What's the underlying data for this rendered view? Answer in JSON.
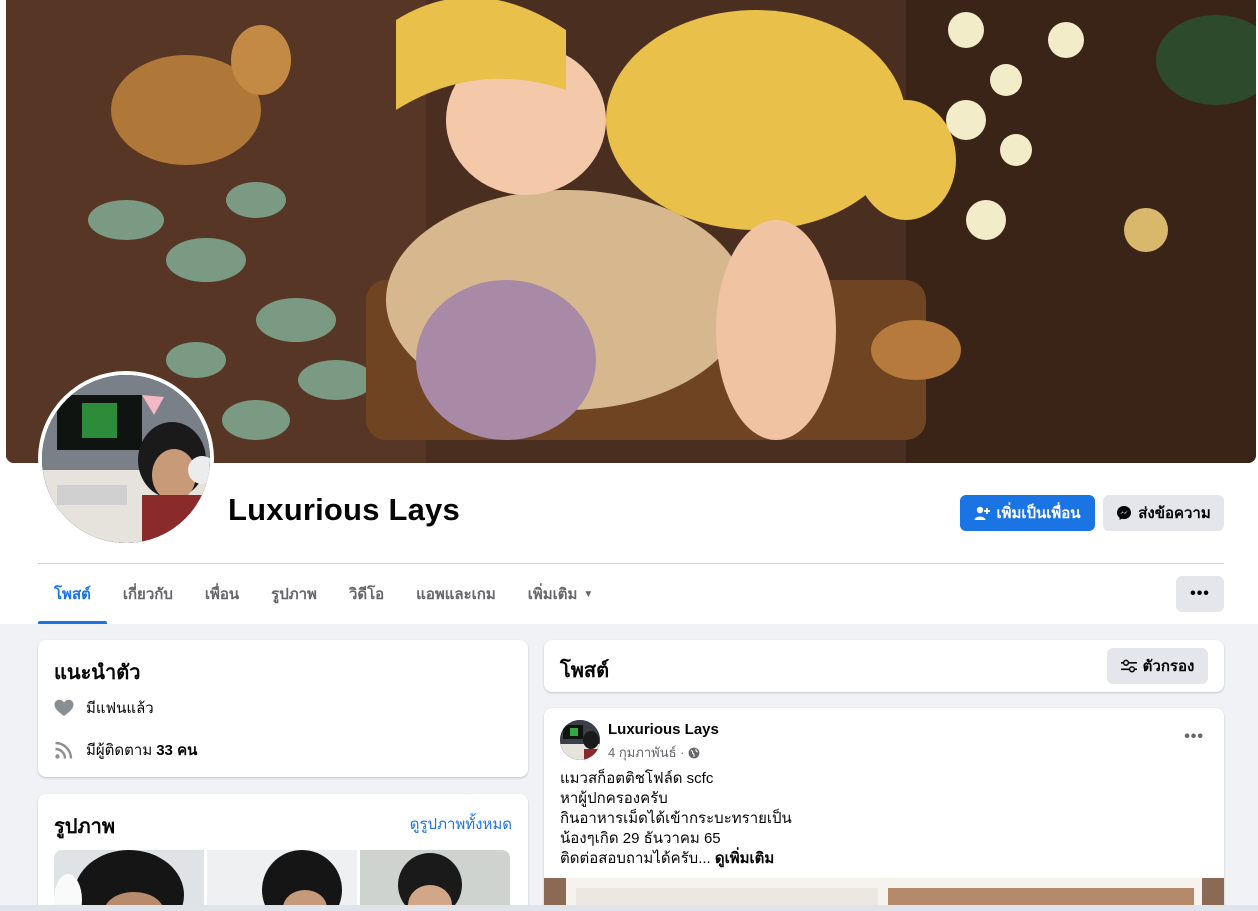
{
  "profile": {
    "name": "Luxurious Lays",
    "add_friend_label": "เพิ่มเป็นเพื่อน",
    "message_label": "ส่งข้อความ"
  },
  "tabs": [
    {
      "label": "โพสต์"
    },
    {
      "label": "เกี่ยวกับ"
    },
    {
      "label": "เพื่อน"
    },
    {
      "label": "รูปภาพ"
    },
    {
      "label": "วิดีโอ"
    },
    {
      "label": "แอพและเกม"
    },
    {
      "label": "เพิ่มเติม"
    }
  ],
  "intro": {
    "title": "แนะนำตัว",
    "relationship": "มีแฟนแล้ว",
    "followers_prefix": "มีผู้ติดตาม",
    "followers_count": "33 คน"
  },
  "photos": {
    "title": "รูปภาพ",
    "see_all": "ดูรูปภาพทั้งหมด"
  },
  "posts": {
    "title": "โพสต์",
    "filter_label": "ตัวกรอง"
  },
  "post": {
    "author": "Luxurious Lays",
    "date": "4 กุมภาพันธ์ ·",
    "lines": [
      "แมวสก็อตติชโฟล์ด scfc",
      "หาผู้ปกครองครับ",
      "กินอาหารเม็ดได้เข้ากระบะทรายเป็น",
      "น้องๆเกิด 29 ธันวาคม 65",
      "ติดต่อสอบถามได้ครับ..."
    ],
    "see_more": "ดูเพิ่มเติม"
  },
  "colors": {
    "accent": "#1b74e4",
    "secondary_button": "#e4e6eb",
    "page_bg": "#f0f2f5"
  },
  "icons": [
    "add-friend-icon",
    "messenger-icon",
    "heart-icon",
    "rss-icon",
    "filter-icon",
    "globe-icon",
    "more-dots-icon",
    "caret-down-icon"
  ]
}
